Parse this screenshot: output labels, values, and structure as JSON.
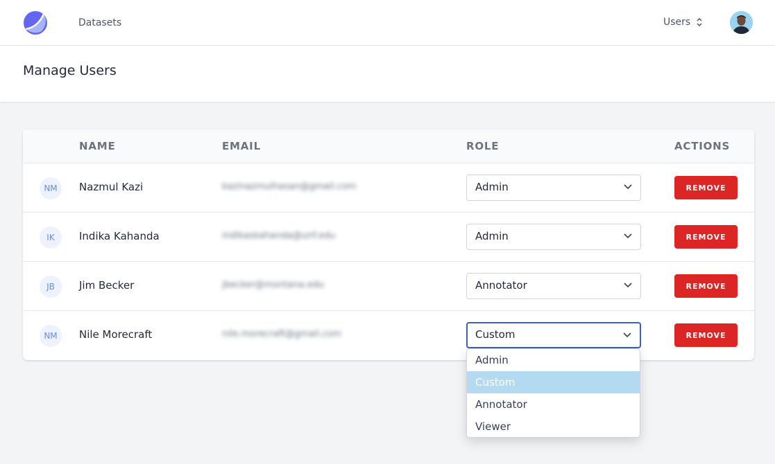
{
  "nav": {
    "link": "Datasets",
    "switcher": "Users"
  },
  "page": {
    "title": "Manage Users"
  },
  "table": {
    "headers": [
      "NAME",
      "EMAIL",
      "ROLE",
      "ACTIONS"
    ],
    "rows": [
      {
        "initials": "NM",
        "name": "Nazmul Kazi",
        "email": "kazinazmulhasan@gmail.com",
        "role": "Admin",
        "action": "REMOVE"
      },
      {
        "initials": "IK",
        "name": "Indika Kahanda",
        "email": "indikaskahanda@unf.edu",
        "role": "Admin",
        "action": "REMOVE"
      },
      {
        "initials": "JB",
        "name": "Jim Becker",
        "email": "jbecker@montana.edu",
        "role": "Annotator",
        "action": "REMOVE"
      },
      {
        "initials": "NM",
        "name": "Nile Morecraft",
        "email": "nile.morecraft@gmail.com",
        "role": "Custom",
        "action": "REMOVE"
      }
    ]
  },
  "dropdown": {
    "options": [
      "Admin",
      "Custom",
      "Annotator",
      "Viewer"
    ],
    "selected": "Custom"
  },
  "colors": {
    "accent": "#3b5fc0",
    "danger": "#dc2626",
    "highlight": "#b3daf1"
  }
}
